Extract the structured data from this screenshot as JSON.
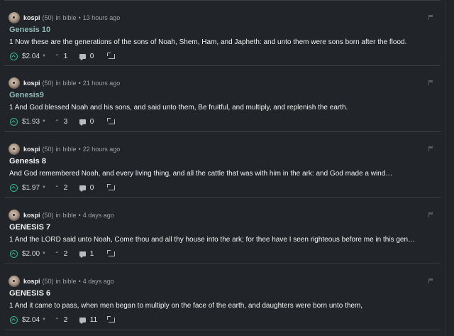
{
  "colors": {
    "background": "#212529",
    "accent_teal": "#8fb8b4",
    "vote_green": "#33b28a",
    "muted_text": "#9aa0a6"
  },
  "posts": [
    {
      "author": "kospi",
      "reputation": "(50)",
      "in_label": "in",
      "community": "bible",
      "dot": "•",
      "time": "13 hours ago",
      "title": "Genesis 10",
      "title_style": "teal",
      "body": "1 Now these are the generations of the sons of Noah, Shem, Ham, and Japheth: and unto them were sons born after the flood.",
      "payout": "$2.04",
      "votes": "1",
      "comments": "0"
    },
    {
      "author": "kospi",
      "reputation": "(50)",
      "in_label": "in",
      "community": "bible",
      "dot": "•",
      "time": "21 hours ago",
      "title": "Genesis9",
      "title_style": "teal",
      "body": "1 And God blessed Noah and his sons, and said unto them, Be fruitful, and multiply, and replenish the earth.",
      "payout": "$1.93",
      "votes": "3",
      "comments": "0"
    },
    {
      "author": "kospi",
      "reputation": "(50)",
      "in_label": "in",
      "community": "bible",
      "dot": "•",
      "time": "22 hours ago",
      "title": "Genesis 8",
      "title_style": "white",
      "body": "And God remembered Noah, and every living thing, and all the cattle that was with him in the ark: and God made a wind…",
      "payout": "$1.97",
      "votes": "2",
      "comments": "0"
    },
    {
      "author": "kospi",
      "reputation": "(50)",
      "in_label": "in",
      "community": "bible",
      "dot": "•",
      "time": "4 days ago",
      "title": "GENESIS 7",
      "title_style": "white",
      "body": "1 And the LORD said unto Noah, Come thou and all thy house into the ark; for thee have I seen righteous before me in this gen…",
      "payout": "$2.00",
      "votes": "2",
      "comments": "1"
    },
    {
      "author": "kospi",
      "reputation": "(50)",
      "in_label": "in",
      "community": "bible",
      "dot": "•",
      "time": "4 days ago",
      "title": "GENESIS 6",
      "title_style": "white",
      "body": "1 And it came to pass, when men began to multiply on the face of the earth, and daughters were born unto them,",
      "payout": "$2.04",
      "votes": "2",
      "comments": "11"
    }
  ]
}
